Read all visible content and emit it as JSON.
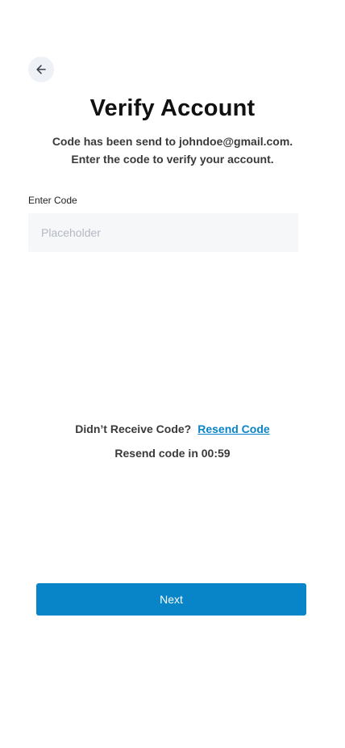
{
  "header": {
    "back_icon": "arrow-left-icon",
    "title": "Verify Account"
  },
  "subtitle": {
    "line1": "Code has been send to johndoe@gmail.com.",
    "line2": "Enter the code to verify your account."
  },
  "code_field": {
    "label": "Enter Code",
    "placeholder": "Placeholder",
    "value": ""
  },
  "resend": {
    "prompt": "Didn’t Receive Code?",
    "link_label": "Resend Code",
    "timer_text": "Resend code in 00:59"
  },
  "actions": {
    "next_label": "Next"
  },
  "colors": {
    "primary": "#0884c8",
    "link": "#0a84c6",
    "input_background": "#f6f7f9",
    "back_button_background": "#eef1f6"
  }
}
